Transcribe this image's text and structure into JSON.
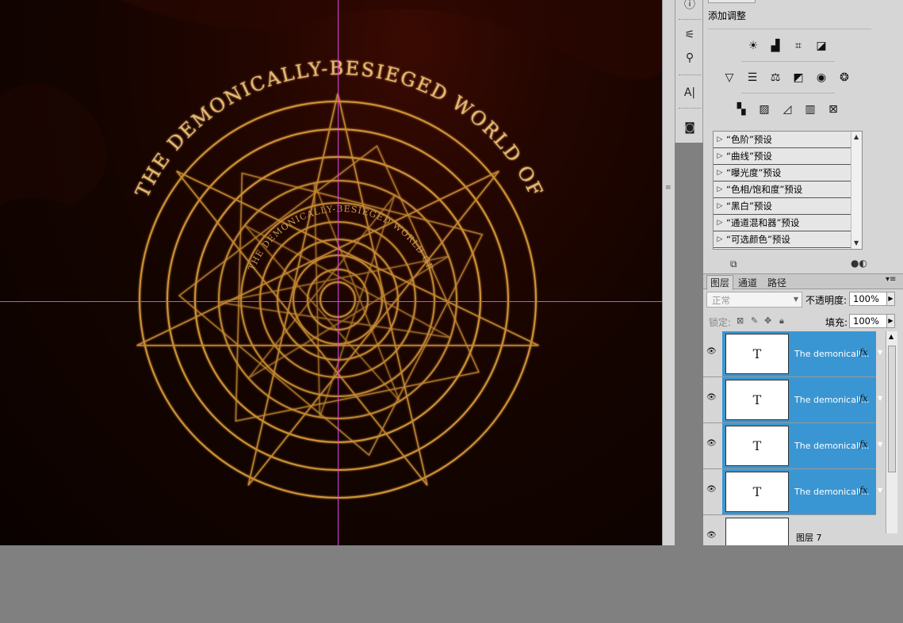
{
  "canvas": {
    "arc_text": "THE DEMONICALLY-BESIEGED WORLD OF",
    "inner_text": "THE DEMONICALLY-BESIEGED WORLD OF"
  },
  "toolstrip": {
    "icons": [
      "info-icon",
      "sliders-icon",
      "usb-icon",
      "character-icon",
      "camera-icon"
    ]
  },
  "adjustments": {
    "title": "添加调整",
    "row1": [
      "brightness-icon",
      "levels-icon",
      "curves-icon",
      "exposure-icon"
    ],
    "row2": [
      "vibrance-icon",
      "hue-saturation-icon",
      "color-balance-icon",
      "black-white-icon",
      "photo-filter-icon",
      "channel-mixer-icon"
    ],
    "row3": [
      "invert-icon",
      "posterize-icon",
      "threshold-icon",
      "gradient-map-icon",
      "selective-color-icon"
    ],
    "presets": [
      "“色阶”预设",
      "“曲线”预设",
      "“曝光度”预设",
      "“色相/饱和度”预设",
      "“黑白”预设",
      "“通道混和器”预设",
      "“可选颜色”预设"
    ]
  },
  "layers_panel": {
    "tabs": [
      "图层",
      "通道",
      "路径"
    ],
    "blend_mode": "正常",
    "opacity_label": "不透明度:",
    "opacity_value": "100%",
    "lock_label": "锁定:",
    "fill_label": "填充:",
    "fill_value": "100%",
    "layers": [
      {
        "name": "The demonicall...",
        "thumb": "T",
        "fx": "fx",
        "selected": true
      },
      {
        "name": "The demonicall...",
        "thumb": "T",
        "fx": "fx",
        "selected": true
      },
      {
        "name": "The demonicall...",
        "thumb": "T",
        "fx": "fx",
        "selected": true
      },
      {
        "name": "The demonicall...",
        "thumb": "T",
        "fx": "fx",
        "selected": true
      },
      {
        "name": "图层 7",
        "thumb": "",
        "fx": "",
        "selected": false
      }
    ]
  },
  "colors": {
    "guide": "#e040e0",
    "gold": "#d99a3a",
    "selection": "#3a96d2"
  }
}
